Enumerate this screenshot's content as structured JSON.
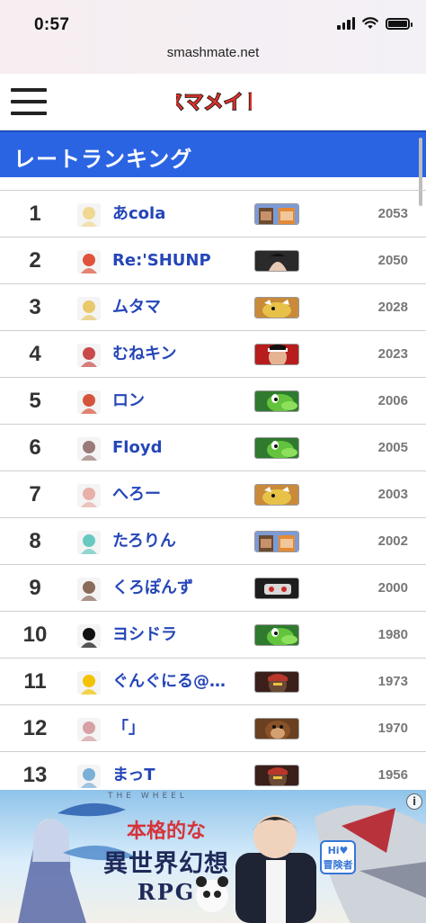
{
  "status_bar": {
    "time": "0:57"
  },
  "browser": {
    "url": "smashmate.net"
  },
  "site": {
    "logo_text": "スマメイト"
  },
  "page": {
    "title": "レートランキング"
  },
  "ranking": [
    {
      "rank": "1",
      "name": "あcola",
      "rate": "2053",
      "avatar": "#f0d890",
      "fighter": "steve"
    },
    {
      "rank": "2",
      "name": "Re:'SHUNP",
      "rate": "2050",
      "avatar": "#e0523a",
      "fighter": "hero"
    },
    {
      "rank": "3",
      "name": "ムタマ",
      "rate": "2028",
      "avatar": "#e8c86a",
      "fighter": "bowser"
    },
    {
      "rank": "4",
      "name": "むねキン",
      "rate": "2023",
      "avatar": "#c94a4a",
      "fighter": "ryu"
    },
    {
      "rank": "5",
      "name": "ロン",
      "rate": "2006",
      "avatar": "#d4553b",
      "fighter": "yoshi"
    },
    {
      "rank": "6",
      "name": "Floyd",
      "rate": "2005",
      "avatar": "#9a7a78",
      "fighter": "yoshi"
    },
    {
      "rank": "7",
      "name": "へろー",
      "rate": "2003",
      "avatar": "#e7b0a8",
      "fighter": "bowser"
    },
    {
      "rank": "8",
      "name": "たろりん",
      "rate": "2002",
      "avatar": "#68c9c0",
      "fighter": "steve"
    },
    {
      "rank": "9",
      "name": "くろぽんず",
      "rate": "2000",
      "avatar": "#8a6a58",
      "fighter": "rob"
    },
    {
      "rank": "10",
      "name": "ヨシドラ",
      "rate": "1980",
      "avatar": "#111111",
      "fighter": "yoshi"
    },
    {
      "rank": "11",
      "name": "ぐんぐにる@…",
      "rate": "1973",
      "avatar": "#f3c300",
      "fighter": "ganondorf"
    },
    {
      "rank": "12",
      "name": "「」",
      "rate": "1970",
      "avatar": "#d7a0a6",
      "fighter": "dk"
    },
    {
      "rank": "13",
      "name": "まっT",
      "rate": "1956",
      "avatar": "#7ab0d8",
      "fighter": "ganondorf"
    }
  ],
  "ad": {
    "line1": "本格的な",
    "line2": "異世界幻想",
    "line3": "RPG",
    "badge": "Hi♥ 冒険者",
    "info": "i"
  }
}
